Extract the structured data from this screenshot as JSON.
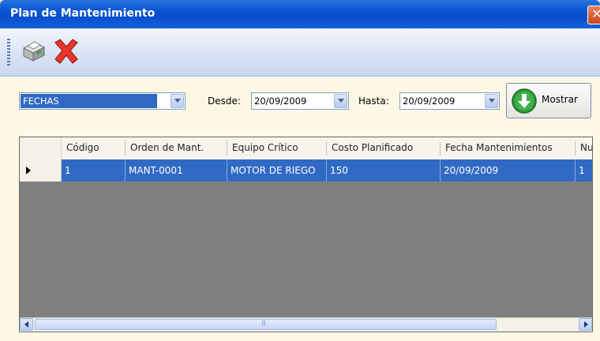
{
  "window": {
    "title": "Plan de Mantenimiento",
    "close_symbol": "✕"
  },
  "toolbar": {
    "items": [
      {
        "icon": "printer-icon"
      },
      {
        "icon": "delete-icon"
      }
    ]
  },
  "filters": {
    "type_value": "FECHAS",
    "desde_label": "Desde:",
    "desde_value": "20/09/2009",
    "hasta_label": "Hasta:",
    "hasta_value": "20/09/2009",
    "mostrar_label": "Mostrar"
  },
  "grid": {
    "columns": [
      "Código",
      "Orden de Mant.",
      "Equipo Crítico",
      "Costo Planificado",
      "Fecha Mantenimientos",
      "Nu"
    ],
    "rows": [
      [
        "1",
        "MANT-0001",
        "MOTOR DE RIEGO",
        "150",
        "20/09/2009",
        "1"
      ]
    ]
  },
  "colors": {
    "selection": "#316ac5",
    "titlebar": "#0754d4",
    "grid_empty": "#808080"
  }
}
